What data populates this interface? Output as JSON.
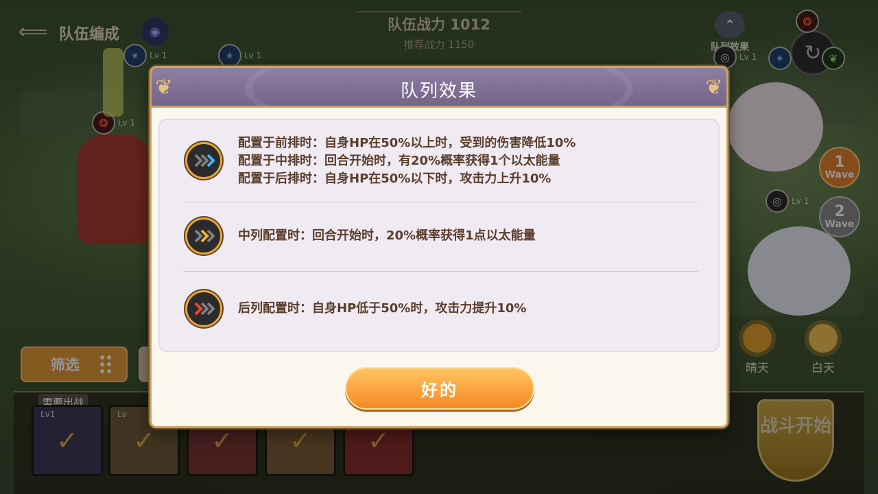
{
  "header": {
    "back_label": "队伍编成",
    "team_power": "队伍战力 1012",
    "recommended_power": "推荐战力 1150"
  },
  "formation_button": {
    "label": "队列效果",
    "icon": "formation-icon"
  },
  "unit_levels": {
    "top_left_1": "Lv 1",
    "top_left_2": "Lv 1",
    "left_red": "Lv 1",
    "enemy_top": "Lv 1",
    "enemy_mid": "Lv 1",
    "card_1": "Lv1",
    "card_2": "Lv"
  },
  "waves": [
    {
      "num": "1",
      "label": "Wave",
      "state": "active"
    },
    {
      "num": "2",
      "label": "Wave",
      "state": "idle"
    }
  ],
  "weather": [
    {
      "label": "晴天",
      "icon": "sun-icon"
    },
    {
      "label": "白天",
      "icon": "sun-icon"
    }
  ],
  "filter_button": {
    "label": "筛选",
    "icon": "dots-grid-icon"
  },
  "roster": {
    "tag": "需要出战"
  },
  "battle_start": {
    "label": "战斗开始"
  },
  "dialog": {
    "title": "队列效果",
    "effects": [
      {
        "icon": "chevron-blue-icon",
        "color": "#3fb6f0",
        "lines": [
          "配置于前排时：自身HP在50%以上时，受到的伤害降低10%",
          "配置于中排时：回合开始时，有20%概率获得1个以太能量",
          "配置于后排时：自身HP在50%以下时，攻击力上升10%"
        ]
      },
      {
        "icon": "chevron-yellow-icon",
        "color": "#f1b12c",
        "lines": [
          "中列配置时：回合开始时，20%概率获得1点以太能量"
        ]
      },
      {
        "icon": "chevron-red-icon",
        "color": "#f0472c",
        "lines": [
          "后列配置时：自身HP低于50%时，攻击力提升10%"
        ]
      }
    ],
    "ok_label": "好的"
  },
  "colors": {
    "dialog_header": "#7d6d92",
    "dialog_border": "#c9a46a",
    "ok_button": "#f7a33c",
    "text_brown": "#5a3e2c"
  }
}
